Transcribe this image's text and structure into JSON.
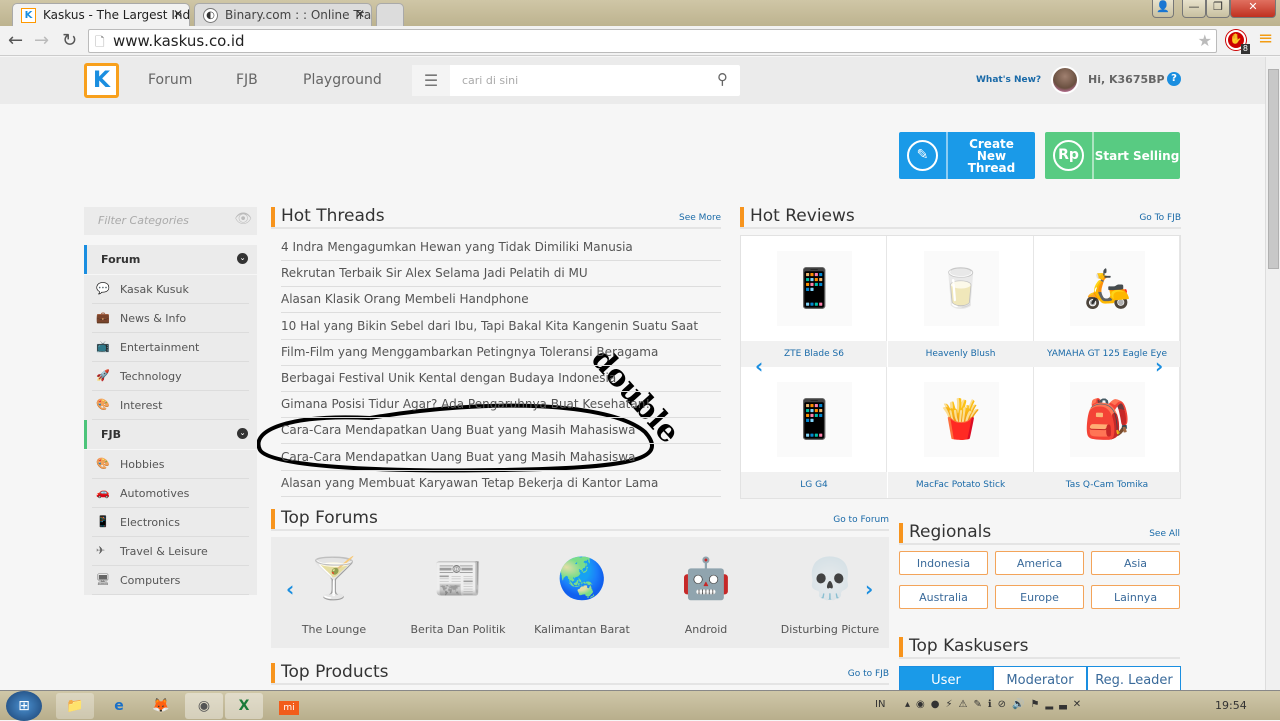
{
  "browser": {
    "tabs": [
      {
        "title": "Kaskus - The Largest Indo",
        "active": true
      },
      {
        "title": "Binary.com : : Online Tradi",
        "active": false
      }
    ],
    "url": "www.kaskus.co.id",
    "extension_badge": "8"
  },
  "header": {
    "logo": "K",
    "nav": [
      "Forum",
      "FJB",
      "Playground"
    ],
    "search_placeholder": "cari di sini",
    "whats_new": "What's New?",
    "greeting": "Hi, K3675BP",
    "help": "?"
  },
  "actions": {
    "create_thread": "Create New Thread",
    "start_selling": "Start Selling",
    "rp_icon": "Rp"
  },
  "sidebar": {
    "filter_placeholder": "Filter Categories",
    "sections": [
      {
        "title": "Forum",
        "accent": "#1a8ee0",
        "items": [
          {
            "label": "Kasak Kusuk",
            "icon": "chat-icon"
          },
          {
            "label": "News & Info",
            "icon": "briefcase-icon"
          },
          {
            "label": "Entertainment",
            "icon": "tv-icon"
          },
          {
            "label": "Technology",
            "icon": "rocket-icon"
          },
          {
            "label": "Interest",
            "icon": "palette-icon"
          }
        ]
      },
      {
        "title": "FJB",
        "accent": "#4cc47a",
        "items": [
          {
            "label": "Hobbies",
            "icon": "palette-icon"
          },
          {
            "label": "Automotives",
            "icon": "car-icon"
          },
          {
            "label": "Electronics",
            "icon": "phone-icon"
          },
          {
            "label": "Travel & Leisure",
            "icon": "plane-icon"
          },
          {
            "label": "Computers",
            "icon": "monitor-icon"
          }
        ]
      }
    ]
  },
  "hot_threads": {
    "title": "Hot Threads",
    "more": "See More",
    "items": [
      "4 Indra Mengagumkan Hewan yang Tidak Dimiliki Manusia",
      "Rekrutan Terbaik Sir Alex Selama Jadi Pelatih di MU",
      "Alasan Klasik Orang Membeli Handphone",
      "10 Hal yang Bikin Sebel dari Ibu, Tapi Bakal Kita Kangenin Suatu Saat",
      "Film-Film yang Menggambarkan Petingnya Toleransi Beragama",
      "Berbagai Festival Unik Kental dengan Budaya Indonesia",
      "Gimana Posisi Tidur Agar? Ada Pengaruhnya Buat Kesehatan!",
      "Cara-Cara Mendapatkan Uang Buat yang Masih Mahasiswa",
      "Cara-Cara Mendapatkan Uang Buat yang Masih Mahasiswa",
      "Alasan yang Membuat Karyawan Tetap Bekerja di Kantor Lama"
    ],
    "annotation": "double"
  },
  "hot_reviews": {
    "title": "Hot Reviews",
    "more": "Go To FJB",
    "items": [
      {
        "label": "ZTE Blade S6",
        "emoji": "📱"
      },
      {
        "label": "Heavenly Blush",
        "emoji": "🥛"
      },
      {
        "label": "YAMAHA GT 125 Eagle Eye",
        "emoji": "🛵"
      },
      {
        "label": "LG G4",
        "emoji": "📱"
      },
      {
        "label": "MacFac Potato Stick",
        "emoji": "🍟"
      },
      {
        "label": "Tas Q-Cam Tomika",
        "emoji": "🎒"
      }
    ]
  },
  "top_forums": {
    "title": "Top Forums",
    "more": "Go to Forum",
    "items": [
      {
        "label": "The Lounge",
        "emoji": "🍸"
      },
      {
        "label": "Berita Dan Politik",
        "emoji": "📰"
      },
      {
        "label": "Kalimantan Barat",
        "emoji": "🌏"
      },
      {
        "label": "Android",
        "emoji": "🤖"
      },
      {
        "label": "Disturbing Picture",
        "emoji": "💀"
      }
    ]
  },
  "top_products": {
    "title": "Top Products",
    "more": "Go to FJB"
  },
  "regionals": {
    "title": "Regionals",
    "more": "See All",
    "items": [
      "Indonesia",
      "America",
      "Asia",
      "Australia",
      "Europe",
      "Lainnya"
    ]
  },
  "top_kaskusers": {
    "title": "Top Kaskusers",
    "tabs": [
      "User",
      "Moderator",
      "Reg. Leader"
    ],
    "active": "User"
  },
  "taskbar": {
    "language": "IN",
    "clock": "19:54"
  },
  "colors": {
    "blue": "#1a8ee0",
    "green": "#58cb82",
    "orange": "#f7941d"
  }
}
